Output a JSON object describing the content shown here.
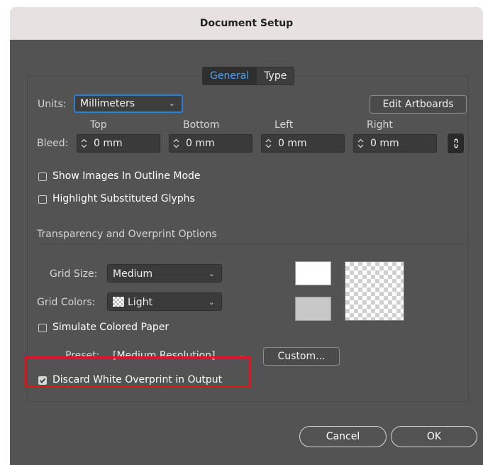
{
  "window": {
    "title": "Document Setup"
  },
  "tabs": [
    {
      "label": "General",
      "active": true
    },
    {
      "label": "Type",
      "active": false
    }
  ],
  "units": {
    "label": "Units:",
    "value": "Millimeters"
  },
  "edit_artboards_label": "Edit Artboards",
  "bleed": {
    "label": "Bleed:",
    "fields": [
      {
        "name": "Top",
        "value": "0 mm"
      },
      {
        "name": "Bottom",
        "value": "0 mm"
      },
      {
        "name": "Left",
        "value": "0 mm"
      },
      {
        "name": "Right",
        "value": "0 mm"
      }
    ],
    "link_icon": "chain-link-icon"
  },
  "options": {
    "show_images_outline": {
      "label": "Show Images In Outline Mode",
      "checked": false
    },
    "highlight_substituted_glyphs": {
      "label": "Highlight Substituted Glyphs",
      "checked": false
    }
  },
  "transparency": {
    "section_title": "Transparency and Overprint Options",
    "grid_size": {
      "label": "Grid Size:",
      "value": "Medium"
    },
    "grid_colors": {
      "label": "Grid Colors:",
      "value": "Light"
    },
    "simulate_colored_paper": {
      "label": "Simulate Colored Paper",
      "checked": false
    },
    "preset": {
      "label": "Preset:",
      "value": "[Medium Resolution]"
    },
    "custom_label": "Custom...",
    "discard_white_overprint": {
      "label": "Discard White Overprint in Output",
      "checked": true
    }
  },
  "footer": {
    "cancel_label": "Cancel",
    "ok_label": "OK"
  },
  "colors": {
    "dialog_bg": "#535353",
    "title_bg": "#e7e1e1",
    "accent": "#2d7fd3",
    "highlight": "#e0141c"
  }
}
